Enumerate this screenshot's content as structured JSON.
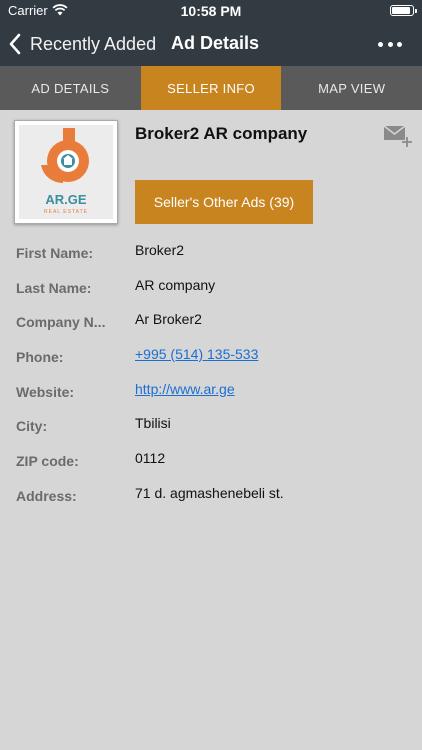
{
  "status_bar": {
    "carrier": "Carrier",
    "time": "10:58 PM"
  },
  "nav": {
    "back_label": "Recently Added",
    "title": "Ad Details"
  },
  "tabs": [
    {
      "label": "AD DETAILS",
      "active": false
    },
    {
      "label": "SELLER INFO",
      "active": true
    },
    {
      "label": "MAP VIEW",
      "active": false
    }
  ],
  "logo": {
    "brand": "AR.GE",
    "tagline": "REAL ESTATE"
  },
  "seller": {
    "name": "Broker2 AR company",
    "other_ads_label": "Seller's Other Ads (39)"
  },
  "fields": [
    {
      "label": "First Name:",
      "value": "Broker2"
    },
    {
      "label": "Last Name:",
      "value": "AR company"
    },
    {
      "label": "Company N...",
      "value": "Ar Broker2"
    },
    {
      "label": "Phone:",
      "value": "+995 (514) 135-533",
      "link": true
    },
    {
      "label": "Website:",
      "value": "http://www.ar.ge",
      "link": true
    },
    {
      "label": "City:",
      "value": "Tbilisi"
    },
    {
      "label": "ZIP code:",
      "value": "0112"
    },
    {
      "label": "Address:",
      "value": "71 d. agmashenebeli st."
    }
  ],
  "colors": {
    "accent": "#c8841f",
    "header": "#323a42",
    "tabbar": "#5a5a5a",
    "background": "#d6d6d6",
    "link": "#1b6fd1",
    "logo_orange": "#e97c3b",
    "logo_teal": "#3a8ea0"
  }
}
